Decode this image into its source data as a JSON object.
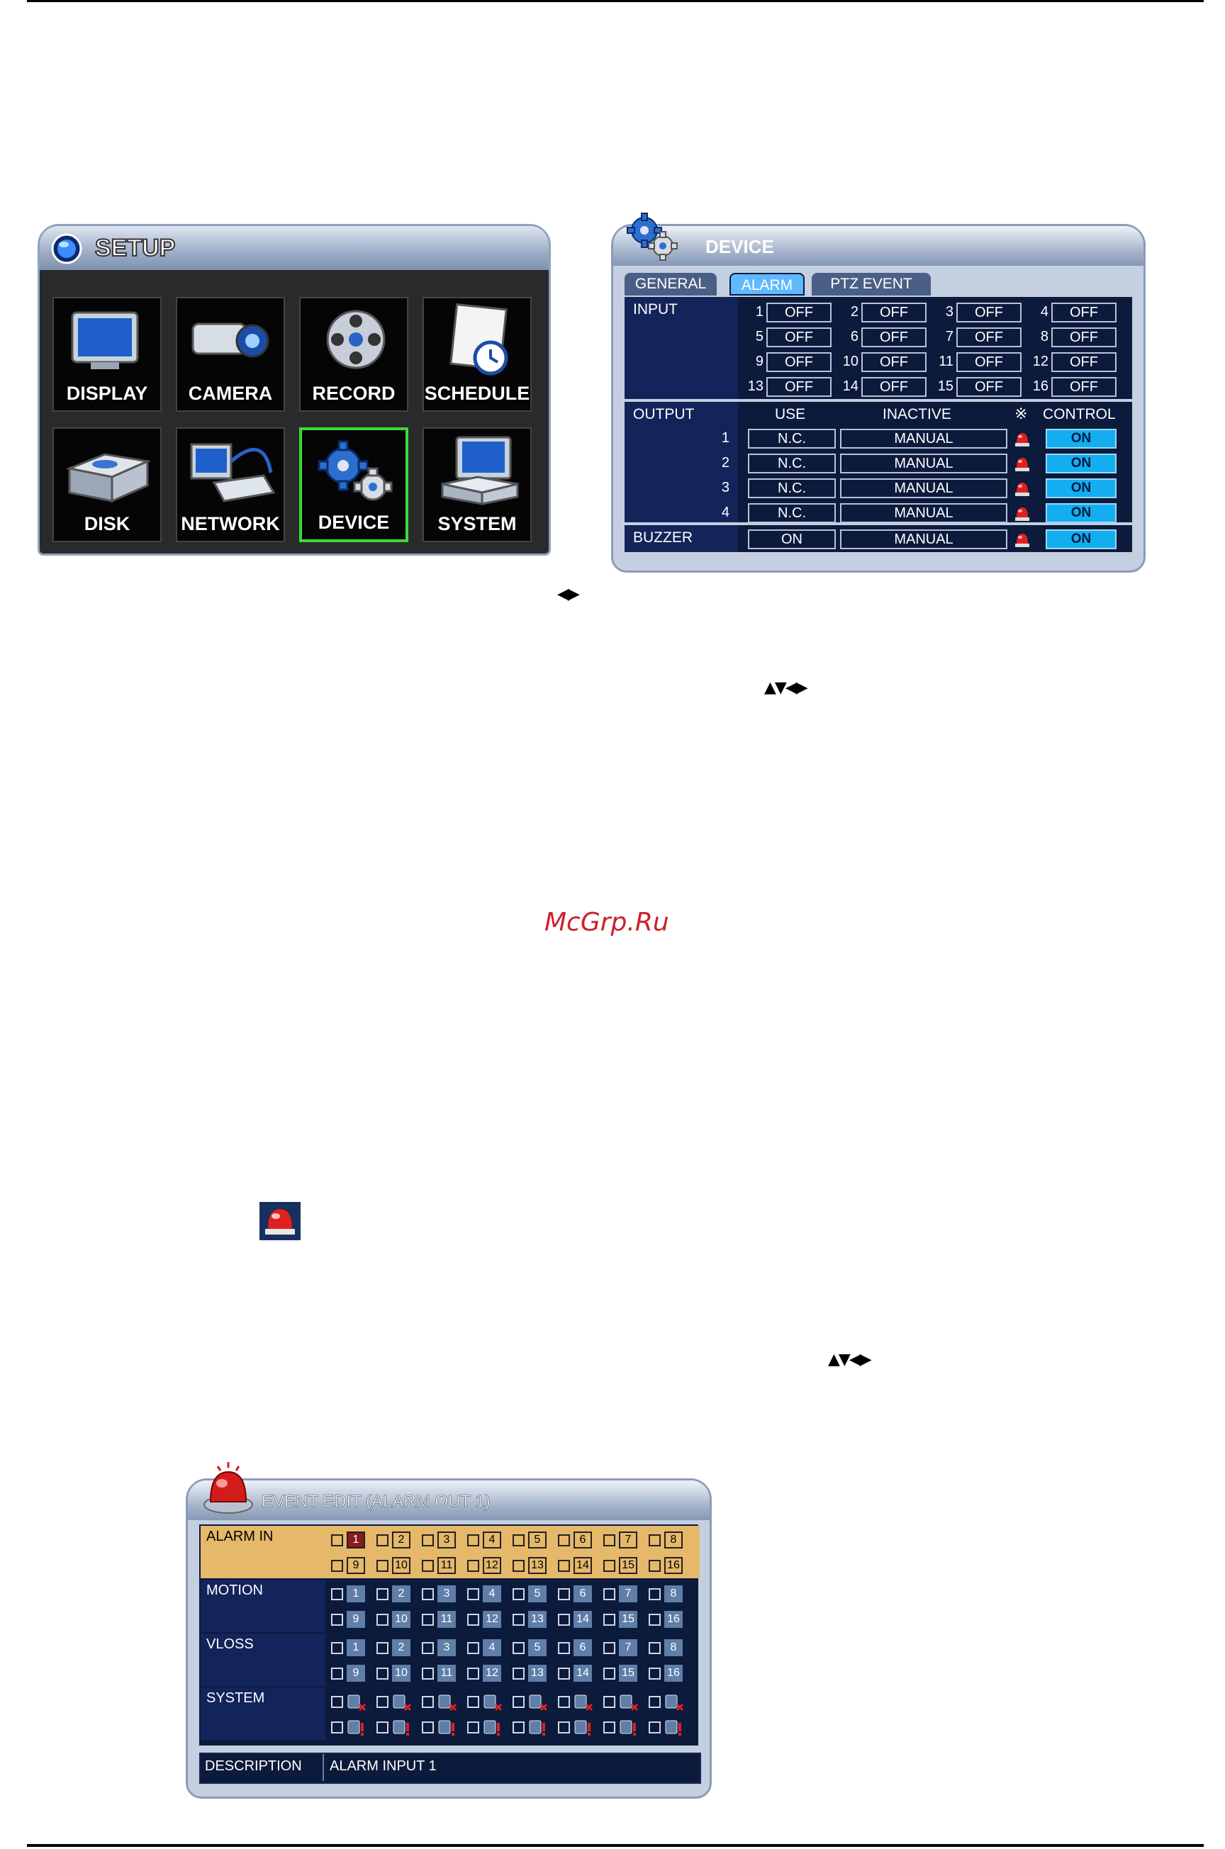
{
  "watermark": "McGrp.Ru",
  "setup": {
    "title": "SETUP",
    "tiles": [
      {
        "label": "DISPLAY",
        "icon": "display-monitor-icon"
      },
      {
        "label": "CAMERA",
        "icon": "camera-icon"
      },
      {
        "label": "RECORD",
        "icon": "film-reel-icon"
      },
      {
        "label": "SCHEDULE",
        "icon": "notepad-clock-icon"
      },
      {
        "label": "DISK",
        "icon": "disk-drive-icon"
      },
      {
        "label": "NETWORK",
        "icon": "network-device-icon"
      },
      {
        "label": "DEVICE",
        "icon": "gears-icon"
      },
      {
        "label": "SYSTEM",
        "icon": "computer-system-icon"
      }
    ],
    "selected": "DEVICE",
    "selected_color": "#3fd838"
  },
  "device": {
    "title": "DEVICE",
    "tabs": [
      {
        "label": "GENERAL",
        "active": false
      },
      {
        "label": "ALARM",
        "active": true
      },
      {
        "label": "PTZ EVENT",
        "active": false
      }
    ],
    "input_label": "INPUT",
    "inputs": [
      {
        "n": "1",
        "v": "OFF"
      },
      {
        "n": "2",
        "v": "OFF"
      },
      {
        "n": "3",
        "v": "OFF"
      },
      {
        "n": "4",
        "v": "OFF"
      },
      {
        "n": "5",
        "v": "OFF"
      },
      {
        "n": "6",
        "v": "OFF"
      },
      {
        "n": "7",
        "v": "OFF"
      },
      {
        "n": "8",
        "v": "OFF"
      },
      {
        "n": "9",
        "v": "OFF"
      },
      {
        "n": "10",
        "v": "OFF"
      },
      {
        "n": "11",
        "v": "OFF"
      },
      {
        "n": "12",
        "v": "OFF"
      },
      {
        "n": "13",
        "v": "OFF"
      },
      {
        "n": "14",
        "v": "OFF"
      },
      {
        "n": "15",
        "v": "OFF"
      },
      {
        "n": "16",
        "v": "OFF"
      }
    ],
    "output_label": "OUTPUT",
    "col_use": "USE",
    "col_inactive": "INACTIVE",
    "col_control": "CONTROL",
    "outputs": [
      {
        "n": "1",
        "use": "N.C.",
        "inactive": "MANUAL",
        "control": "ON"
      },
      {
        "n": "2",
        "use": "N.C.",
        "inactive": "MANUAL",
        "control": "ON"
      },
      {
        "n": "3",
        "use": "N.C.",
        "inactive": "MANUAL",
        "control": "ON"
      },
      {
        "n": "4",
        "use": "N.C.",
        "inactive": "MANUAL",
        "control": "ON"
      }
    ],
    "buzzer": {
      "label": "BUZZER",
      "use": "ON",
      "inactive": "MANUAL",
      "control": "ON"
    },
    "accent": "#13aef0"
  },
  "event": {
    "title": "EVENT EDIT (ALARM OUT 1)",
    "rows": [
      {
        "label": "ALARM IN",
        "kind": "numbers",
        "highlight": true
      },
      {
        "label": "MOTION",
        "kind": "numbers",
        "highlight": false
      },
      {
        "label": "VLOSS",
        "kind": "numbers",
        "highlight": false
      },
      {
        "label": "SYSTEM",
        "kind": "icons",
        "highlight": false
      }
    ],
    "numbers": [
      "1",
      "2",
      "3",
      "4",
      "5",
      "6",
      "7",
      "8",
      "9",
      "10",
      "11",
      "12",
      "13",
      "14",
      "15",
      "16"
    ],
    "description_label": "DESCRIPTION",
    "description_value": "ALARM INPUT 1",
    "highlight_color": "#e5b86a"
  },
  "inline_icons": [
    "left-right-arrows-icon",
    "up-down-left-right-arrows-icon",
    "alarm-siren-icon",
    "up-down-left-right-arrows-icon"
  ]
}
